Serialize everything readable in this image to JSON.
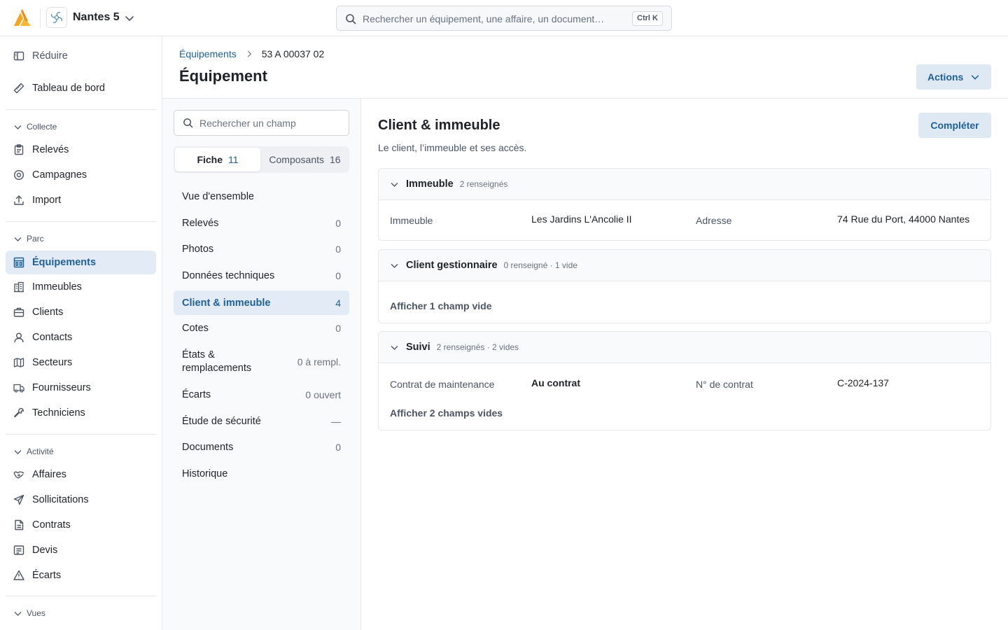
{
  "app": {
    "org_name": "Nantes 5",
    "search_placeholder": "Rechercher un équipement, une affaire, un document…",
    "search_shortcut": "Ctrl K"
  },
  "sidebar": {
    "collapse_label": "Réduire",
    "dashboard_label": "Tableau de bord",
    "groups": {
      "collecte": "Collecte",
      "parc": "Parc",
      "activite": "Activité",
      "vues": "Vues"
    },
    "items": {
      "releves": "Relevés",
      "campagnes": "Campagnes",
      "import": "Import",
      "equipements": "Équipements",
      "immeubles": "Immeubles",
      "clients": "Clients",
      "contacts": "Contacts",
      "secteurs": "Secteurs",
      "fournisseurs": "Fournisseurs",
      "techniciens": "Techniciens",
      "affaires": "Affaires",
      "sollicitations": "Sollicitations",
      "contrats": "Contrats",
      "devis": "Devis",
      "ecarts": "Écarts"
    }
  },
  "header": {
    "breadcrumb_parent": "Équipements",
    "breadcrumb_current": "53 A 00037 02",
    "title": "Équipement",
    "actions_label": "Actions"
  },
  "fields_panel": {
    "search_placeholder": "Rechercher un champ",
    "tabs": [
      {
        "label": "Fiche",
        "count": "11"
      },
      {
        "label": "Composants",
        "count": "16"
      }
    ],
    "sections": [
      {
        "label": "Vue d'ensemble",
        "count": ""
      },
      {
        "label": "Relevés",
        "count": "0"
      },
      {
        "label": "Photos",
        "count": "0"
      },
      {
        "label": "Données techniques",
        "count": "0"
      },
      {
        "label": "Client & immeuble",
        "count": "4"
      },
      {
        "label": "Cotes",
        "count": "0"
      },
      {
        "label": "États & remplacements",
        "count": "0 à rempl."
      },
      {
        "label": "Écarts",
        "count": "0 ouvert"
      },
      {
        "label": "Étude de sécurité",
        "count": "—"
      },
      {
        "label": "Documents",
        "count": "0"
      },
      {
        "label": "Historique",
        "count": ""
      }
    ]
  },
  "main": {
    "title": "Client & immeuble",
    "subtitle": "Le client, l’immeuble et ses accès.",
    "complete_label": "Compléter",
    "cards": {
      "immeuble": {
        "title": "Immeuble",
        "meta": "2 renseignés",
        "k1": "Immeuble",
        "v1": "Les Jardins L'Ancolie II",
        "k2": "Adresse",
        "v2": "74 Rue du Port, 44000 Nantes"
      },
      "client": {
        "title": "Client gestionnaire",
        "meta": "0 renseigné · 1 vide",
        "show_empty": "Afficher 1 champ vide"
      },
      "suivi": {
        "title": "Suivi",
        "meta": "2 renseignés · 2 vides",
        "k1": "Contrat de maintenance",
        "v1": "Au contrat",
        "k2": "N° de contrat",
        "v2": "C-2024-137",
        "show_empty": "Afficher 2 champs vides"
      }
    }
  },
  "colors": {
    "accent": "#1d5f99",
    "accent_bg": "#e3ecf6",
    "logo": "#f5a623"
  }
}
